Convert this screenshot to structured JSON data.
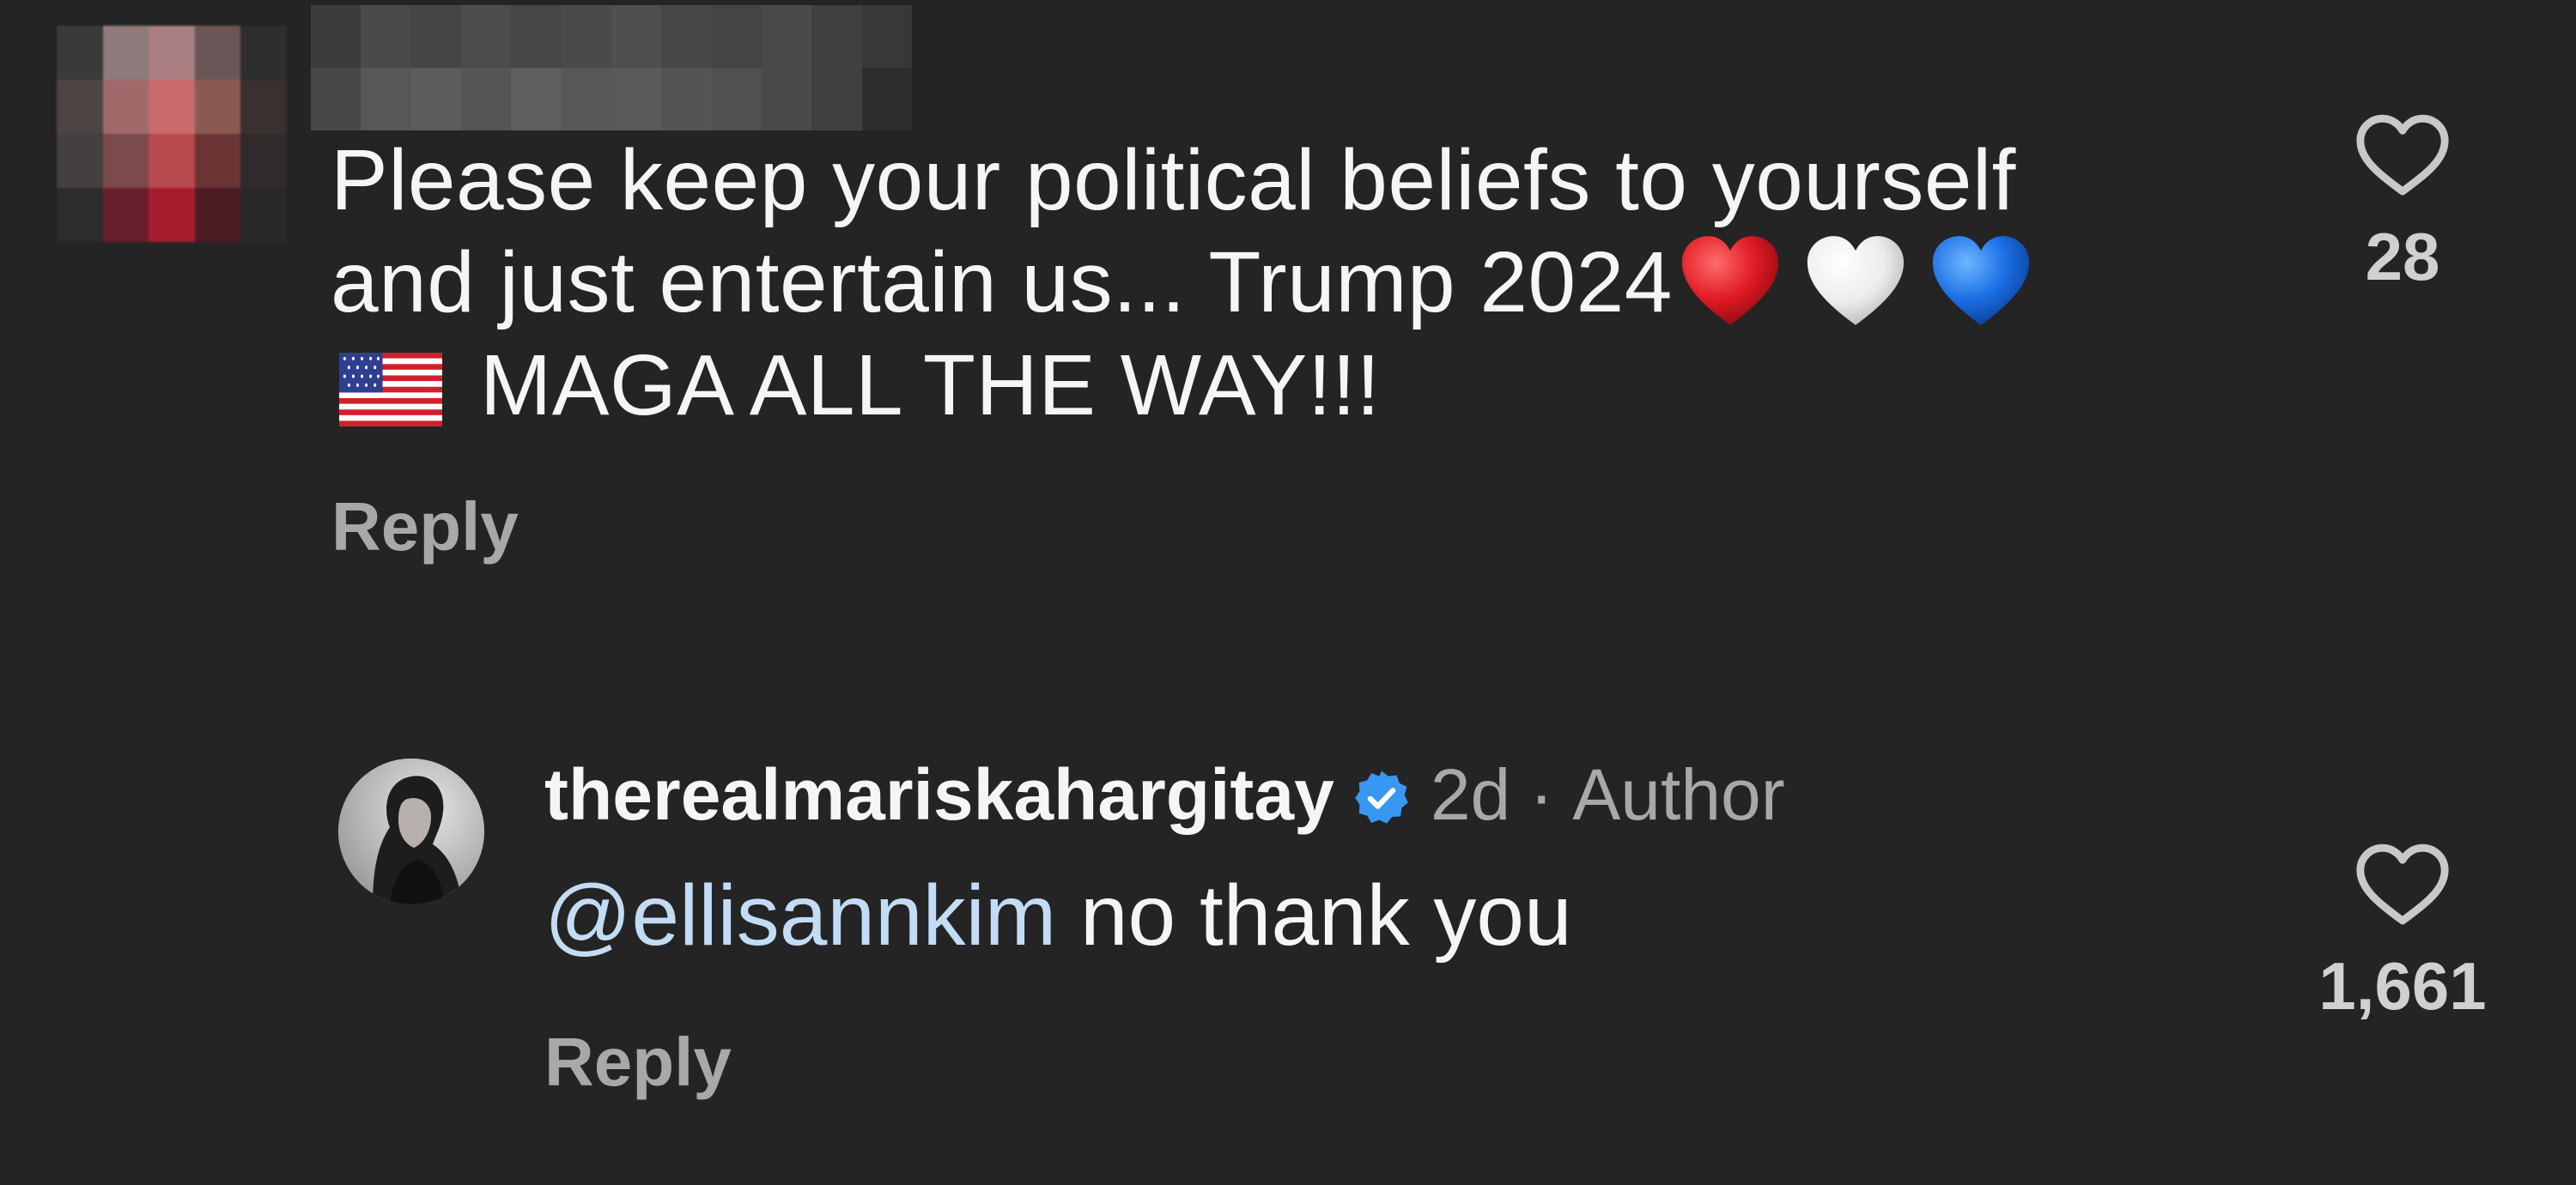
{
  "comments": [
    {
      "text_lines": [
        "Please keep your political beliefs to yourself",
        "and just entertain us... Trump 2024",
        "MAGA ALL THE WAY!!!"
      ],
      "reply_label": "Reply",
      "like_count": "28"
    }
  ],
  "author_reply": {
    "username": "therealmariskahargitay",
    "time": "2d",
    "separator": "·",
    "author_label": "Author",
    "mention": "@ellisannkim",
    "text": " no thank you",
    "reply_label": "Reply",
    "like_count": "1,661"
  },
  "icons": {
    "like": "heart-outline-icon",
    "verified": "verified-badge-icon",
    "emoji": [
      "red-heart-emoji",
      "white-heart-emoji",
      "blue-heart-emoji",
      "us-flag-emoji"
    ]
  },
  "colors": {
    "background": "#242424",
    "text": "#f5f5f5",
    "secondary": "#a8a8a8",
    "mention": "#c3dcf5",
    "verified": "#3897f0"
  }
}
